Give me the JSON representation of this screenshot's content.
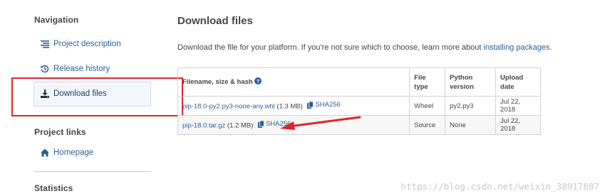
{
  "sidebar": {
    "navigation_heading": "Navigation",
    "items": [
      {
        "label": "Project description",
        "icon": "align-left-icon"
      },
      {
        "label": "Release history",
        "icon": "history-icon"
      },
      {
        "label": "Download files",
        "icon": "download-icon",
        "active": true
      }
    ],
    "project_links_heading": "Project links",
    "homepage_label": "Homepage",
    "statistics_heading": "Statistics"
  },
  "main": {
    "title": "Download files",
    "intro_text": "Download the file for your platform. If you're not sure which to choose, learn more about ",
    "intro_link": "installing packages",
    "intro_end": ".",
    "table": {
      "headers": {
        "filename": "Filename, size & hash",
        "file_type": "File type",
        "python_version_line1": "Python",
        "python_version_line2": "version",
        "upload_date_line1": "Upload",
        "upload_date_line2": "date"
      },
      "rows": [
        {
          "filename": "pip-18.0-py2.py3-none-any.whl",
          "size": "(1.3 MB)",
          "hash_label": "SHA256",
          "file_type": "Wheel",
          "python_version": "py2.py3",
          "upload_date": "Jul 22, 2018"
        },
        {
          "filename": "pip-18.0.tar.gz",
          "size": "(1.2 MB)",
          "hash_label": "SHA256",
          "file_type": "Source",
          "python_version": "None",
          "upload_date": "Jul 22, 2018"
        }
      ]
    }
  },
  "watermark": "https://blog.csdn.net/weixin_38917807",
  "colors": {
    "link": "#2e5e96",
    "text": "#464646",
    "annotation_red": "#e0242a"
  }
}
